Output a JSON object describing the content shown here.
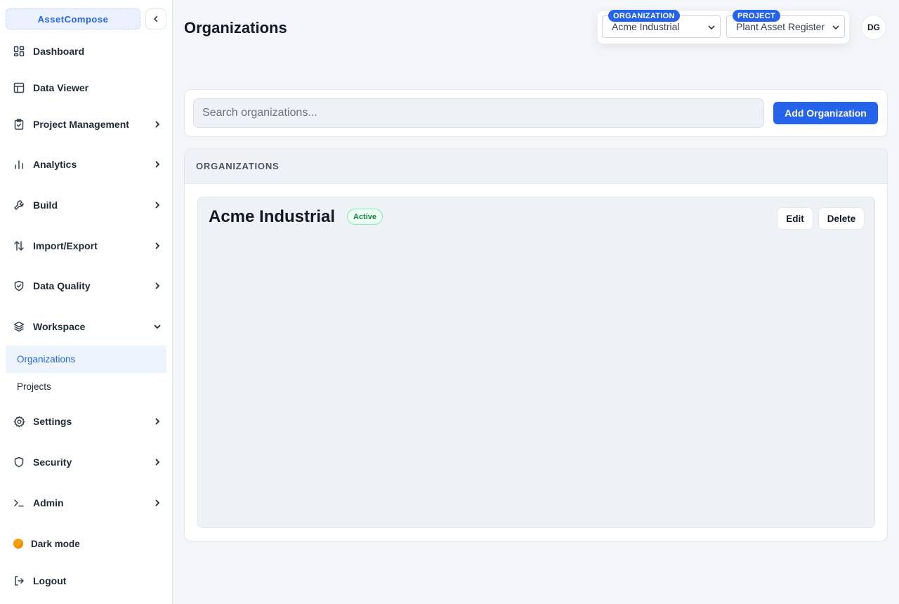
{
  "app": {
    "name": "AssetCompose"
  },
  "sidebar": {
    "items": [
      {
        "label": "Dashboard"
      },
      {
        "label": "Data Viewer"
      },
      {
        "label": "Project Management"
      },
      {
        "label": "Analytics"
      },
      {
        "label": "Build"
      },
      {
        "label": "Import/Export"
      },
      {
        "label": "Data Quality"
      },
      {
        "label": "Workspace"
      },
      {
        "label": "Settings"
      },
      {
        "label": "Security"
      },
      {
        "label": "Admin"
      }
    ],
    "workspace_sub": [
      {
        "label": "Organizations",
        "active": true
      },
      {
        "label": "Projects",
        "active": false
      }
    ],
    "dark_mode_label": "Dark mode",
    "logout_label": "Logout"
  },
  "header": {
    "title": "Organizations",
    "organization_badge": "ORGANIZATION",
    "organization_value": "Acme Industrial",
    "project_badge": "PROJECT",
    "project_value": "Plant Asset Register",
    "avatar_initials": "DG"
  },
  "search": {
    "placeholder": "Search organizations...",
    "add_label": "Add Organization"
  },
  "list": {
    "header": "ORGANIZATIONS",
    "organizations": [
      {
        "name": "Acme Industrial",
        "status": "Active",
        "edit_label": "Edit",
        "delete_label": "Delete"
      }
    ]
  },
  "colors": {
    "accent": "#2563eb",
    "active_bg": "#eef4fe",
    "status_green": "#15803d"
  }
}
